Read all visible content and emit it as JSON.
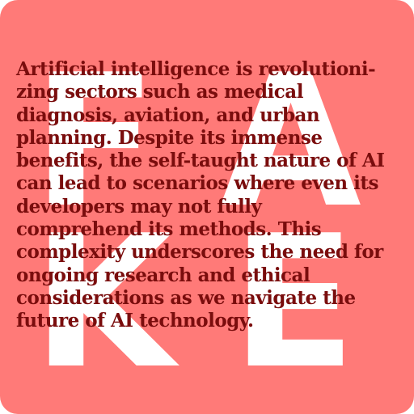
{
  "watermark": {
    "letters": [
      "F",
      "A",
      "K",
      "E"
    ],
    "color": "#ffffff"
  },
  "background_color": "#ff7a78",
  "text_color": "#7a0d0d",
  "paragraph": {
    "lines": [
      "Artificial intelligence is revolutioni-",
      "zing sectors such as medical",
      "diagnosis, aviation, and urban",
      "planning. Despite its immense",
      "benefits, the self-taught nature of AI",
      "can lead to scenarios where even its",
      "developers may not fully",
      "comprehend its methods. This",
      "complexity underscores the need for",
      "ongoing research and ethical",
      "considerations as we navigate the",
      "future of AI technology."
    ]
  }
}
